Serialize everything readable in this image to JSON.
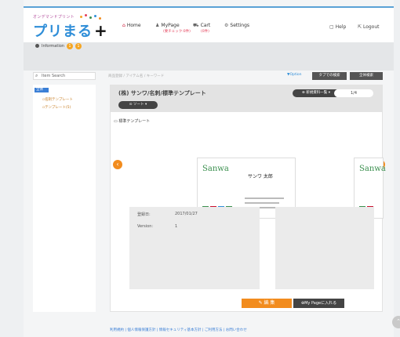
{
  "header": {
    "tagline": "オンデマンドプリント",
    "logo": "プリまる",
    "logo_plus": "+",
    "nav": [
      {
        "label": "Home",
        "sub": ""
      },
      {
        "label": "MyPage",
        "sub": "(要チェック:0件)"
      },
      {
        "label": "Cart",
        "sub": "(0件)"
      },
      {
        "label": "Settings",
        "sub": ""
      }
    ],
    "help": "Help",
    "logout": "Logout"
  },
  "info": {
    "label": "Information",
    "badge1": "1",
    "badge2": "1"
  },
  "search": {
    "placeholder": "Item Search",
    "breadcrumb": "商品登録 / アイテム名 / キーワード",
    "option": "▼Option",
    "btn_tab_view": "タブでの検索",
    "btn_all": "全体検索"
  },
  "sidebar": {
    "root": "全体",
    "items": [
      "名刺テンプレート",
      "テンプレート(5)"
    ]
  },
  "main": {
    "title": "(株) サンワ/名刺/標準テンプレート",
    "sort_label": "ソート",
    "stock_btn": "新規資料一覧",
    "pager": "1/4",
    "template_label": "標準テンプレート",
    "card": {
      "brand": "Sanwa",
      "name": "サンワ 太郎"
    },
    "meta": [
      {
        "key": "登録日:",
        "value": "2017/01/27"
      },
      {
        "key": "Version:",
        "value": "1"
      }
    ],
    "edit_btn": "編 集",
    "mypage_btn": "My Pageに入れる"
  },
  "footer": {
    "links": "利用規約 | 個人情報保護方針 | 情報セキュリティ基本方針 | ご利用方法 | お問い合わせ"
  },
  "colors": {
    "accent": "#f28c1e",
    "brand": "#2f8ed8"
  }
}
